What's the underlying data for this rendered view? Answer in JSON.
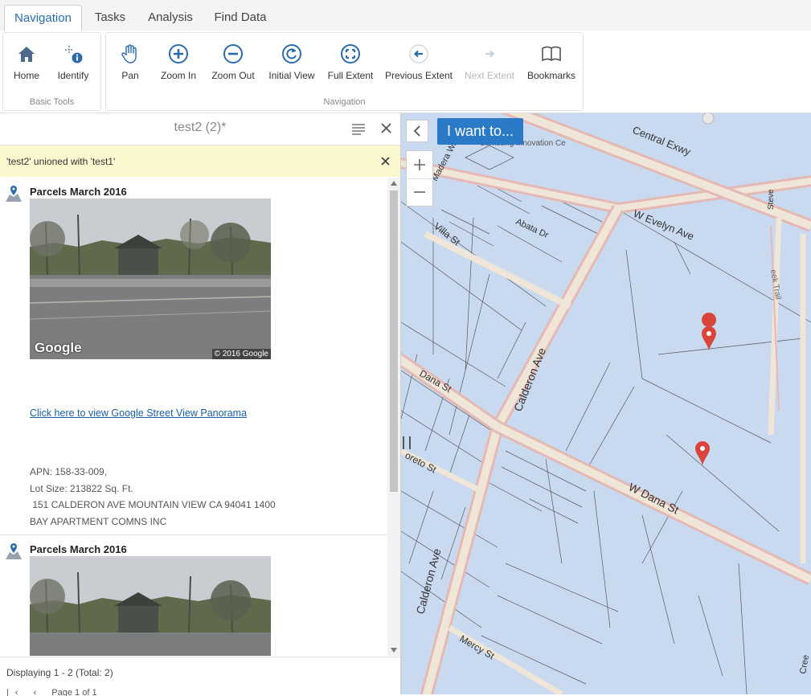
{
  "tabs": [
    {
      "label": "Navigation",
      "active": true
    },
    {
      "label": "Tasks"
    },
    {
      "label": "Analysis"
    },
    {
      "label": "Find Data"
    }
  ],
  "ribbon": {
    "basic_tools": {
      "label": "Basic Tools",
      "tools": [
        {
          "label": "Home",
          "icon": "home-icon"
        },
        {
          "label": "Identify",
          "icon": "identify-icon"
        }
      ]
    },
    "navigation": {
      "label": "Navigation",
      "tools": [
        {
          "label": "Pan",
          "icon": "hand-icon"
        },
        {
          "label": "Zoom In",
          "icon": "zoom-in-icon"
        },
        {
          "label": "Zoom Out",
          "icon": "zoom-out-icon"
        },
        {
          "label": "Initial View",
          "icon": "refresh-icon"
        },
        {
          "label": "Full Extent",
          "icon": "full-extent-icon"
        },
        {
          "label": "Previous Extent",
          "icon": "back-arrow-icon"
        },
        {
          "label": "Next Extent",
          "icon": "forward-arrow-icon",
          "disabled": true
        },
        {
          "label": "Bookmarks",
          "icon": "book-icon"
        }
      ]
    }
  },
  "panel": {
    "title": "test2 (2)*",
    "notice": "'test2' unioned with 'test1'",
    "results": [
      {
        "layer": "Parcels March 2016",
        "photo_brand": "Google",
        "photo_copyright": "© 2016 Google",
        "link": "Click here to view Google Street View Panorama",
        "attributes": [
          "APN: 158-33-009,",
          "Lot Size: 213822 Sq. Ft.",
          " 151 CALDERON AVE MOUNTAIN VIEW CA 94041 1400",
          "BAY APARTMENT COMNS INC"
        ]
      },
      {
        "layer": "Parcels March 2016"
      }
    ],
    "footer": "Displaying 1 - 2 (Total: 2)",
    "pager": "Page 1 of 1"
  },
  "map": {
    "i_want_to": "I want to...",
    "labels": [
      "Central Exwy",
      "W Evelyn Ave",
      "Madera Way",
      "Abata Dr",
      "Villa St",
      "Calderon Ave",
      "Dana St",
      "W Dana St",
      "oreto St",
      "Mercy St",
      "Samsung Innovation Ce",
      "Steve",
      "eek Trail",
      "Cree"
    ]
  },
  "colors": {
    "accent": "#2a6bb0",
    "parcel": "#c9d9f0",
    "road": "#efe6d8",
    "road_edge": "#e4b9b4",
    "notice_bg": "#fbf7cf",
    "pin": "#d9453b",
    "i_want_to_bg": "#2a7ac8"
  }
}
